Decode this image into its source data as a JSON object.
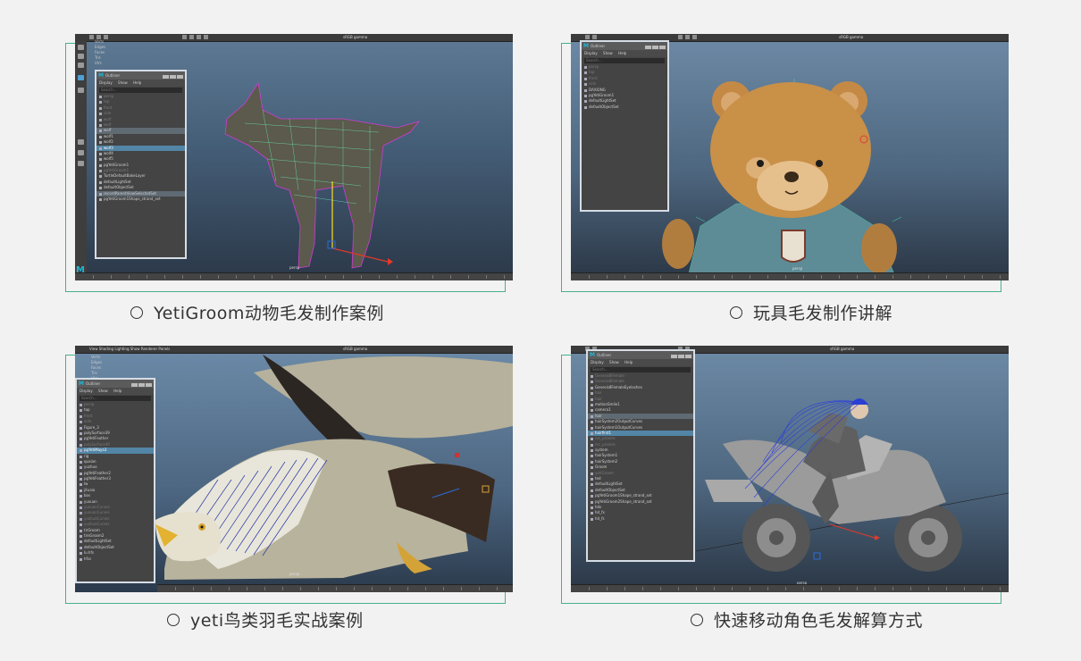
{
  "cards": [
    {
      "caption": "YetiGroom动物毛发制作案例",
      "gamma_label": "sRGB gamma",
      "camera_label": "persp",
      "stats": [
        "Verts",
        "Edges",
        "Faces",
        "Tris",
        "UVs"
      ],
      "outliner": {
        "title": "Outliner",
        "menu": [
          "Display",
          "Show",
          "Help"
        ],
        "search": "Search...",
        "rows": [
          {
            "label": "persp",
            "state": "dim"
          },
          {
            "label": "top",
            "state": "dim"
          },
          {
            "label": "front",
            "state": "dim"
          },
          {
            "label": "side",
            "state": "dim"
          },
          {
            "label": "wolf",
            "state": "dim"
          },
          {
            "label": "wolf",
            "state": "dim"
          },
          {
            "label": "wolf",
            "state": "hl"
          },
          {
            "label": "wolf1",
            "state": ""
          },
          {
            "label": "wolf2",
            "state": ""
          },
          {
            "label": "wolf3",
            "state": "sel"
          },
          {
            "label": "wolf4",
            "state": ""
          },
          {
            "label": "wolf5",
            "state": ""
          },
          {
            "label": "pgYetiGroom1",
            "state": ""
          },
          {
            "label": "pgYetiGroom1",
            "state": "dim"
          },
          {
            "label": "TurtleDefaultBakeLayer",
            "state": ""
          },
          {
            "label": "defaultLightSet",
            "state": ""
          },
          {
            "label": "defaultObjectSet",
            "state": ""
          },
          {
            "label": "recordParentViewSelectedSet",
            "state": "hl"
          },
          {
            "label": "pgYetiGroom1Shape_strand_set",
            "state": ""
          }
        ]
      }
    },
    {
      "caption": "玩具毛发制作讲解",
      "gamma_label": "sRGB gamma",
      "camera_label": "persp",
      "outliner": {
        "title": "Outliner",
        "menu": [
          "Display",
          "Show",
          "Help"
        ],
        "search": "Search...",
        "rows": [
          {
            "label": "persp",
            "state": "dim"
          },
          {
            "label": "top",
            "state": "dim"
          },
          {
            "label": "front",
            "state": "dim"
          },
          {
            "label": "side",
            "state": "dim"
          },
          {
            "label": "DAXIONG",
            "state": ""
          },
          {
            "label": "pgYetiGroom1",
            "state": ""
          },
          {
            "label": "defaultLightSet",
            "state": ""
          },
          {
            "label": "defaultObjectSet",
            "state": ""
          }
        ]
      }
    },
    {
      "caption": "yeti鸟类羽毛实战案例",
      "gamma_label": "sRGB gamma",
      "camera_label": "persp",
      "menubar": [
        "View",
        "Shading",
        "Lighting",
        "Show",
        "Renderer",
        "Panels"
      ],
      "stats": [
        "Verts",
        "Edges",
        "Faces",
        "Tris",
        "UVs"
      ],
      "outliner": {
        "title": "Outliner",
        "menu": [
          "Display",
          "Show",
          "Help"
        ],
        "search": "Search...",
        "rows": [
          {
            "label": "persp",
            "state": "dim"
          },
          {
            "label": "top",
            "state": ""
          },
          {
            "label": "front",
            "state": "dim"
          },
          {
            "label": "side",
            "state": "dim"
          },
          {
            "label": "Figure_3",
            "state": ""
          },
          {
            "label": "polySurface39",
            "state": ""
          },
          {
            "label": "pgYetiFeather",
            "state": ""
          },
          {
            "label": "polySurface49",
            "state": "dim"
          },
          {
            "label": "pgYetiMaya3",
            "state": "sel"
          },
          {
            "label": "rig",
            "state": ""
          },
          {
            "label": "quxian",
            "state": ""
          },
          {
            "label": "yuzhuo",
            "state": ""
          },
          {
            "label": "pgYetiFeather2",
            "state": ""
          },
          {
            "label": "pgYetiFeather3",
            "state": ""
          },
          {
            "label": "lw",
            "state": ""
          },
          {
            "label": "jituaio",
            "state": ""
          },
          {
            "label": "bos",
            "state": ""
          },
          {
            "label": "yuxuan",
            "state": ""
          },
          {
            "label": "yuxuanCurves",
            "state": "dim"
          },
          {
            "label": "yuxuanCurves",
            "state": "dim"
          },
          {
            "label": "yuzhuoCurves",
            "state": "dim"
          },
          {
            "label": "yuzhuoCurves",
            "state": "dim"
          },
          {
            "label": "tirGroom",
            "state": ""
          },
          {
            "label": "tirsGroom2",
            "state": ""
          },
          {
            "label": "defaultLightSet",
            "state": ""
          },
          {
            "label": "defaultObjectSet",
            "state": ""
          },
          {
            "label": "lu.hfs",
            "state": ""
          },
          {
            "label": "hfss",
            "state": ""
          }
        ]
      }
    },
    {
      "caption": "快速移动角色毛发解算方式",
      "gamma_label": "sRGB gamma",
      "camera_label": "persp",
      "outliner": {
        "title": "Outliner",
        "menu": [
          "Display",
          "Show",
          "Help"
        ],
        "search": "Search...",
        "rows": [
          {
            "label": "Genesis8Female",
            "state": "dim"
          },
          {
            "label": "Genesis8Female",
            "state": "dim"
          },
          {
            "label": "Genesis8FemaleEyelashes",
            "state": ""
          },
          {
            "label": "hair",
            "state": "dim"
          },
          {
            "label": "hair",
            "state": "dim"
          },
          {
            "label": "motionSmile1",
            "state": ""
          },
          {
            "label": "camera1",
            "state": ""
          },
          {
            "label": "hair",
            "state": "hl"
          },
          {
            "label": "hairSystem2OutputCurves",
            "state": ""
          },
          {
            "label": "hairSystem1OutputCurves",
            "state": ""
          },
          {
            "label": "hairfirst1",
            "state": "sel"
          },
          {
            "label": "nrc_proxies",
            "state": "dim"
          },
          {
            "label": "nrc_proxies",
            "state": "dim"
          },
          {
            "label": "system",
            "state": ""
          },
          {
            "label": "hairSystem1",
            "state": ""
          },
          {
            "label": "hairSystem2",
            "state": ""
          },
          {
            "label": "Groom",
            "state": ""
          },
          {
            "label": "yetiGroom",
            "state": "dim"
          },
          {
            "label": "ted",
            "state": ""
          },
          {
            "label": "defaultLightSet",
            "state": ""
          },
          {
            "label": "defaultObjectSet",
            "state": ""
          },
          {
            "label": "pgYetiGroom1Shape_strand_set",
            "state": ""
          },
          {
            "label": "pgYetiGroom2Shape_strand_set",
            "state": ""
          },
          {
            "label": "hds",
            "state": ""
          },
          {
            "label": "hd_fx",
            "state": ""
          },
          {
            "label": "hd_fs",
            "state": ""
          }
        ]
      }
    }
  ],
  "colors": {
    "accent_frame": "#49b08a",
    "viewport_top": "#5e7a94",
    "viewport_bottom": "#2b3848",
    "selection": "#5285a6",
    "caption_text": "#333333"
  }
}
